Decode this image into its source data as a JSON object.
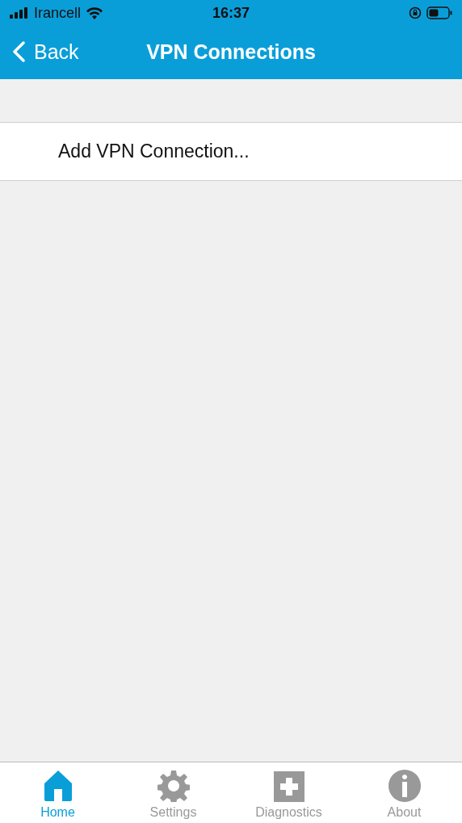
{
  "status_bar": {
    "carrier": "Irancell",
    "time": "16:37"
  },
  "nav": {
    "back": "Back",
    "title": "VPN Connections"
  },
  "list": [
    {
      "label": "Add VPN Connection..."
    }
  ],
  "tabs": [
    {
      "label": "Home",
      "kind": "home",
      "selected": true
    },
    {
      "label": "Settings",
      "kind": "settings",
      "selected": false
    },
    {
      "label": "Diagnostics",
      "kind": "diagnostics",
      "selected": false
    },
    {
      "label": "About",
      "kind": "about",
      "selected": false
    }
  ]
}
